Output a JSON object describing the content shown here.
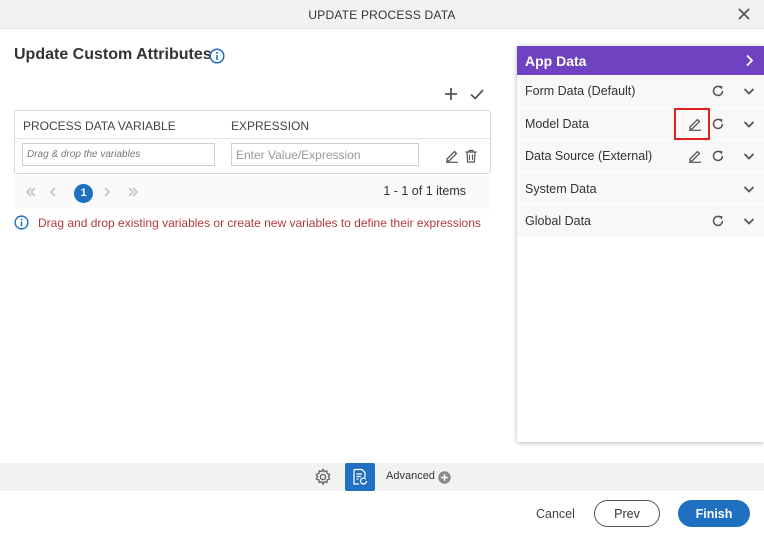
{
  "dialog": {
    "title": "UPDATE PROCESS DATA",
    "close_icon": "close-icon"
  },
  "section": {
    "title": "Update Custom Attributes",
    "info_icon": "info-icon"
  },
  "toolbar": {
    "add_icon": "plus-icon",
    "apply_icon": "check-icon"
  },
  "grid": {
    "columns": [
      "PROCESS DATA VARIABLE",
      "EXPRESSION"
    ],
    "rows": [
      {
        "variable_value": "",
        "variable_placeholder": "Drag & drop the variables",
        "expression_value": "",
        "expression_placeholder": "Enter Value/Expression",
        "edit_icon": "pencil-icon",
        "delete_icon": "trash-icon"
      }
    ]
  },
  "pager": {
    "current_page": "1",
    "info": "1 - 1 of 1 items"
  },
  "hint": {
    "text": "Drag and drop existing variables or create new variables to define their expressions",
    "color": "#b13a3a"
  },
  "app_data": {
    "title": "App Data",
    "header_color": "#6f42c1",
    "items": [
      {
        "label": "Form Data (Default)",
        "icons": [
          "refresh-icon",
          "chevron-down-icon"
        ]
      },
      {
        "label": "Model Data",
        "icons": [
          "pencil-icon",
          "refresh-icon",
          "chevron-down-icon"
        ],
        "highlighted": true
      },
      {
        "label": "Data Source (External)",
        "icons": [
          "pencil-icon",
          "refresh-icon",
          "chevron-down-icon"
        ]
      },
      {
        "label": "System Data",
        "icons": [
          "chevron-down-icon"
        ]
      },
      {
        "label": "Global Data",
        "icons": [
          "refresh-icon",
          "chevron-down-icon"
        ]
      }
    ]
  },
  "footer": {
    "advanced_label": "Advanced",
    "cancel_label": "Cancel",
    "prev_label": "Prev",
    "finish_label": "Finish",
    "accent_color": "#1f70c1"
  }
}
